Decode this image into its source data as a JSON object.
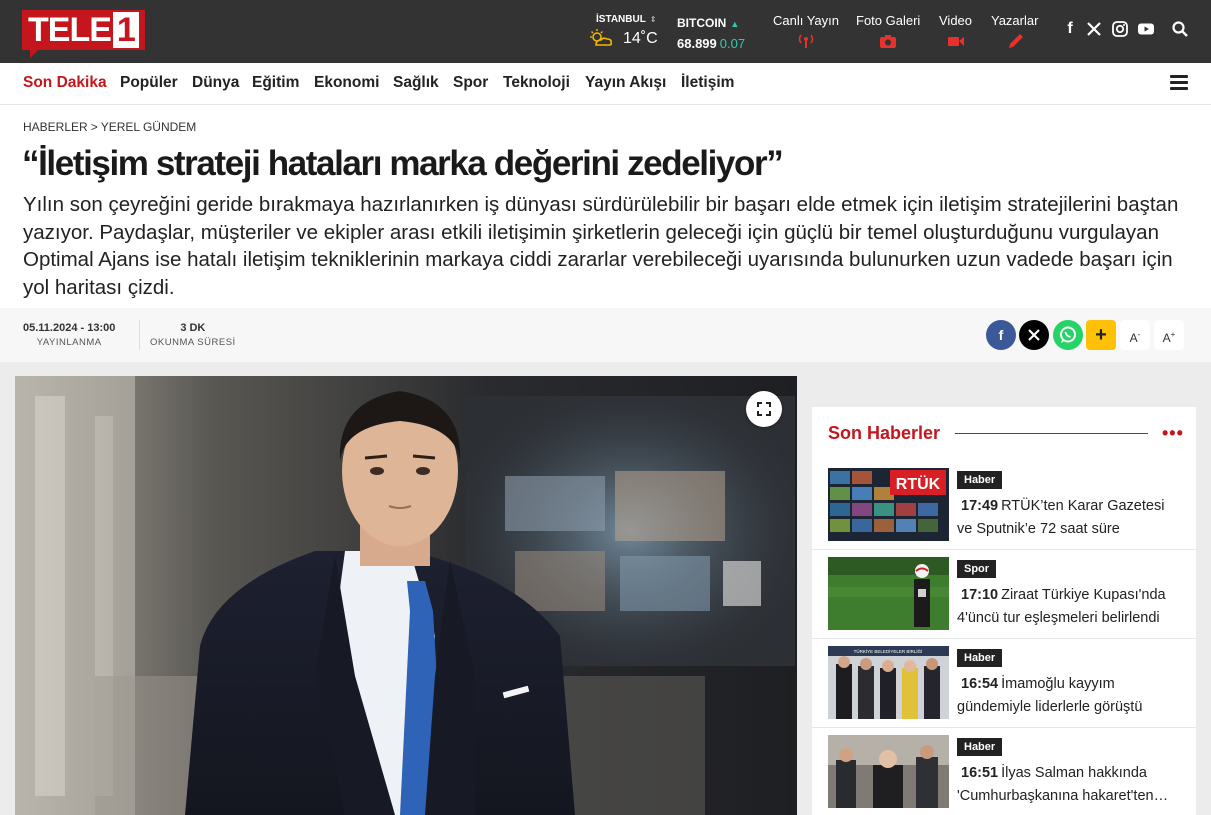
{
  "site": {
    "logo_text": "TELE",
    "logo_number": "1"
  },
  "topbar": {
    "weather": {
      "city": "İSTANBUL",
      "temp": "14˚C",
      "icon": "partly-cloudy-sun-icon"
    },
    "crypto": {
      "name": "BITCOIN",
      "price": "68.899",
      "change": "0.07",
      "trend_color": "#33c9b1"
    },
    "links": [
      {
        "label": "Canlı Yayın",
        "icon": "broadcast-icon"
      },
      {
        "label": "Foto Galeri",
        "icon": "camera-icon"
      },
      {
        "label": "Video",
        "icon": "video-camera-icon"
      },
      {
        "label": "Yazarlar",
        "icon": "pen-icon"
      }
    ],
    "social": [
      "facebook-icon",
      "x-icon",
      "instagram-icon",
      "youtube-icon",
      "search-icon"
    ]
  },
  "nav": {
    "items": [
      "Son Dakika",
      "Popüler",
      "Dünya",
      "Eğitim",
      "Ekonomi",
      "Sağlık",
      "Spor",
      "Teknoloji",
      "Yayın Akışı",
      "İletişim"
    ],
    "active_color": "#c4161c"
  },
  "article": {
    "breadcrumb": [
      "HABERLER",
      "YEREL GÜNDEM"
    ],
    "breadcrumb_sep": ">",
    "title": "“İletişim strateji hataları marka değerini zedeliyor”",
    "summary": "Yılın son çeyreğini geride bırakmaya hazırlanırken iş dünyası sürdürülebilir bir başarı elde etmek için iletişim stratejilerini baştan yazıyor. Paydaşlar, müşteriler ve ekipler arası etkili iletişimin şirketlerin geleceği için güçlü bir temel oluşturduğunu vurgulayan Optimal Ajans ise hatalı iletişim tekniklerinin markaya ciddi zararlar verebileceği uyarısında bulunurken uzun vadede başarı için yol haritası çizdi.",
    "published_value": "05.11.2024 - 13:00",
    "published_label": "YAYINLANMA",
    "read_value": "3 DK",
    "read_label": "OKUNMA SÜRESİ",
    "font_decrease": "A",
    "font_increase": "A",
    "share_colors": {
      "facebook": "#3b5998",
      "x": "#000000",
      "whatsapp": "#25d366",
      "more": "#ffc107"
    }
  },
  "sidebar": {
    "title": "Son Haberler",
    "more": "•••",
    "items": [
      {
        "category": "Haber",
        "time": "17:49",
        "headline": "RTÜK’ten Karar Gazetesi ve Sputnik’e 72 saat süre",
        "thumb_text": "RTÜK"
      },
      {
        "category": "Spor",
        "time": "17:10",
        "headline": "Ziraat Türkiye Kupası'nda 4'üncü tur eşleşmeleri belirlendi"
      },
      {
        "category": "Haber",
        "time": "16:54",
        "headline": "İmamoğlu kayyım gündemiyle liderlerle görüştü",
        "thumb_text": "TÜRKİYE BELEDİYELER BİRLİĞİ"
      },
      {
        "category": "Haber",
        "time": "16:51",
        "headline": "İlyas Salman hakkında 'Cumhurbaşkanına hakaret'ten…"
      }
    ]
  }
}
